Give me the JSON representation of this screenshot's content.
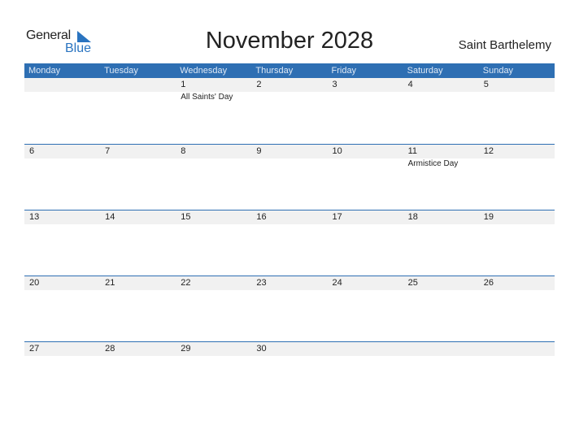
{
  "logo": {
    "general": "General",
    "blue": "Blue"
  },
  "title": "November 2028",
  "country": "Saint Barthelemy",
  "colors": {
    "accent": "#2e6fb3",
    "datebar": "#f1f1f1"
  },
  "weekdays": [
    "Monday",
    "Tuesday",
    "Wednesday",
    "Thursday",
    "Friday",
    "Saturday",
    "Sunday"
  ],
  "weeks": [
    {
      "days": [
        "",
        "",
        "1",
        "2",
        "3",
        "4",
        "5"
      ],
      "events": [
        "",
        "",
        "All Saints' Day",
        "",
        "",
        "",
        ""
      ]
    },
    {
      "days": [
        "6",
        "7",
        "8",
        "9",
        "10",
        "11",
        "12"
      ],
      "events": [
        "",
        "",
        "",
        "",
        "",
        "Armistice Day",
        ""
      ]
    },
    {
      "days": [
        "13",
        "14",
        "15",
        "16",
        "17",
        "18",
        "19"
      ],
      "events": [
        "",
        "",
        "",
        "",
        "",
        "",
        ""
      ]
    },
    {
      "days": [
        "20",
        "21",
        "22",
        "23",
        "24",
        "25",
        "26"
      ],
      "events": [
        "",
        "",
        "",
        "",
        "",
        "",
        ""
      ]
    },
    {
      "days": [
        "27",
        "28",
        "29",
        "30",
        "",
        "",
        ""
      ],
      "events": [
        "",
        "",
        "",
        "",
        "",
        "",
        ""
      ]
    }
  ]
}
